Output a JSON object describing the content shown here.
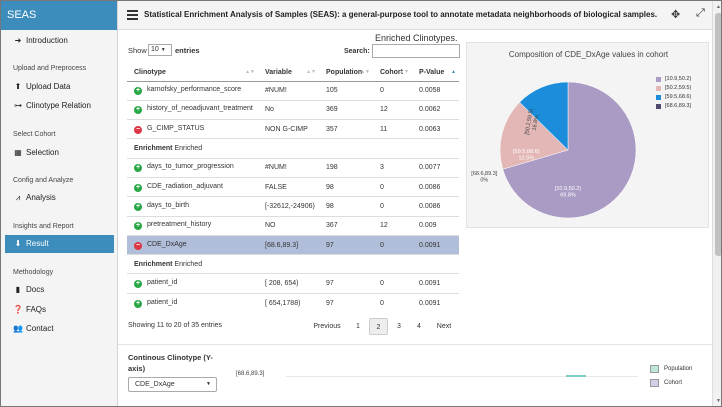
{
  "app": {
    "brand": "SEAS"
  },
  "header": {
    "title": "Statistical Enrichment Analysis of Samples (SEAS): a general-purpose tool to annotate metadata neighborhoods of biological samples."
  },
  "sidebar": {
    "items": [
      {
        "label": "Introduction",
        "icon": "arrow-right-icon"
      },
      {
        "section": "Upload and Preprocess"
      },
      {
        "label": "Upload Data",
        "icon": "upload-icon"
      },
      {
        "label": "Clinotype Relation",
        "icon": "network-icon"
      },
      {
        "section": "Select Cohort"
      },
      {
        "label": "Selection",
        "icon": "table-icon"
      },
      {
        "section": "Config and Analyze"
      },
      {
        "label": "Analysis",
        "icon": "line-chart-icon"
      },
      {
        "section": "Insights and Report"
      },
      {
        "label": "Result",
        "icon": "download-icon",
        "active": true
      },
      {
        "section": "Methodology"
      },
      {
        "label": "Docs",
        "icon": "book-icon"
      },
      {
        "label": "FAQs",
        "icon": "question-icon"
      },
      {
        "label": "Contact",
        "icon": "users-icon"
      }
    ]
  },
  "table": {
    "title": "Enriched Clinotypes.",
    "show_label": "Show",
    "length_value": "10",
    "entries_label": "entries",
    "search_label": "Search:",
    "columns": [
      "Clinotype",
      "Variable",
      "Population",
      "Cohort",
      "P-Value"
    ],
    "rows": [
      {
        "status": "plus",
        "clinotype": "karnofsky_performance_score",
        "variable": "#NUM!",
        "population": "105",
        "cohort": "0",
        "pvalue": "0.0058"
      },
      {
        "status": "plus",
        "clinotype": "history_of_neoadjuvant_treatment",
        "variable": "No",
        "population": "369",
        "cohort": "12",
        "pvalue": "0.0062"
      },
      {
        "status": "minus",
        "clinotype": "G_CIMP_STATUS",
        "variable": "NON G-CIMP",
        "population": "357",
        "cohort": "11",
        "pvalue": "0.0063"
      },
      {
        "group": true,
        "bold": "Enrichment",
        "rest": "Enriched"
      },
      {
        "status": "plus",
        "clinotype": "days_to_tumor_progression",
        "variable": "#NUM!",
        "population": "198",
        "cohort": "3",
        "pvalue": "0.0077"
      },
      {
        "status": "plus",
        "clinotype": "CDE_radiation_adjuvant",
        "variable": "FALSE",
        "population": "98",
        "cohort": "0",
        "pvalue": "0.0086"
      },
      {
        "status": "plus",
        "clinotype": "days_to_birth",
        "variable": "[-32612,-24906)",
        "population": "98",
        "cohort": "0",
        "pvalue": "0.0086"
      },
      {
        "status": "plus",
        "clinotype": "pretreatment_history",
        "variable": "NO",
        "population": "367",
        "cohort": "12",
        "pvalue": "0.009"
      },
      {
        "status": "minus",
        "clinotype": "CDE_DxAge",
        "variable": "[68.6,89.3]",
        "population": "97",
        "cohort": "0",
        "pvalue": "0.0091",
        "selected": true
      },
      {
        "group": true,
        "bold": "Enrichment",
        "rest": "Enriched"
      },
      {
        "status": "plus",
        "clinotype": "patient_id",
        "variable": "[ 208, 654)",
        "population": "97",
        "cohort": "0",
        "pvalue": "0.0091"
      },
      {
        "status": "plus",
        "clinotype": "patient_id",
        "variable": "[ 654,1788)",
        "population": "97",
        "cohort": "0",
        "pvalue": "0.0091"
      }
    ],
    "info": "Showing 11 to 20 of 35 entries",
    "pagination": {
      "previous": "Previous",
      "pages": [
        "1",
        "2",
        "3",
        "4"
      ],
      "current": "2",
      "next": "Next"
    }
  },
  "pie": {
    "title": "Composition of CDE_DxAge values in cohort",
    "labels_shown": {
      "a": [
        "[10.9,50.2)",
        "69.8%"
      ],
      "b": [
        "[50.2,59.5)",
        "16.8%"
      ],
      "c": [
        "[59.5,68.6)",
        "12.5%"
      ],
      "d": [
        "[68.6,89.3]",
        "0%"
      ]
    }
  },
  "chart_data": {
    "type": "pie",
    "title": "Composition of CDE_DxAge values in cohort",
    "labels": [
      "[10.9,50.2)",
      "[50.2,59.5)",
      "[59.5,68.6)",
      "[68.6,89.3]"
    ],
    "values": [
      69.8,
      16.8,
      12.5,
      0
    ],
    "colors": [
      "#a99bc4",
      "#e3b7b6",
      "#1b8ddb",
      "#4d4a6b"
    ],
    "legend_position": "right"
  },
  "continuous": {
    "label": "Continous Clinotype (Y-axis)",
    "selected": "CDE_DxAge",
    "bar_category": "[68.6,89.3]",
    "legend": [
      {
        "name": "Population",
        "color": "#bfe6dd"
      },
      {
        "name": "Cohort",
        "color": "#d4d0ea"
      }
    ]
  }
}
